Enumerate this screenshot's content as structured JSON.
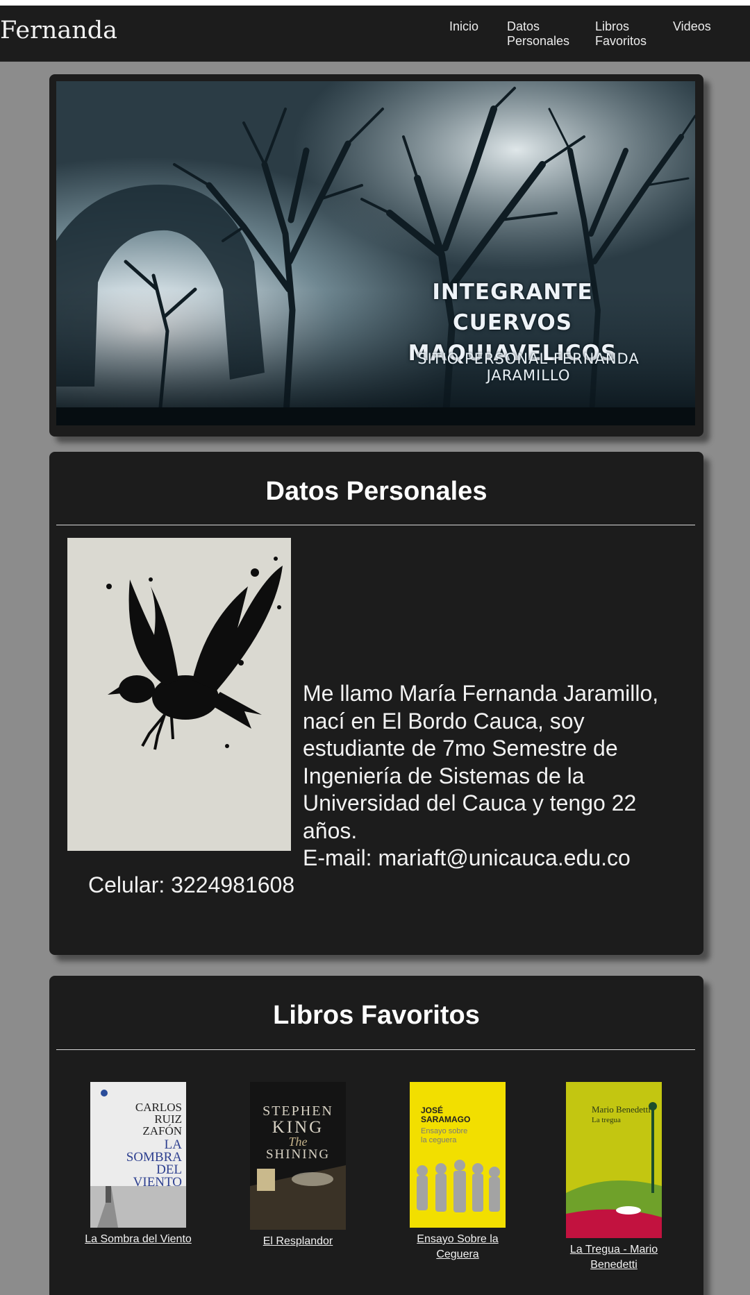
{
  "navbar": {
    "brand": "Fernanda",
    "links": [
      "Inicio",
      "Datos Personales",
      "Libros Favoritos",
      "Videos"
    ],
    "links_lines": [
      [
        "Inicio"
      ],
      [
        "Datos",
        "Personales"
      ],
      [
        "Libros",
        "Favoritos"
      ],
      [
        "Videos"
      ]
    ]
  },
  "hero": {
    "title_line1": "INTEGRANTE CUERVOS",
    "title_line2": "MAQUIAVELICOS",
    "subtitle": "SITIO PERSONAL FERNANDA JARAMILLO"
  },
  "datos": {
    "title": "Datos Personales",
    "bio": "Me llamo María Fernanda Jaramillo, nací en El Bordo Cauca, soy estudiante de 7mo Semestre de Ingeniería de Sistemas de la Universidad del Cauca y tengo 22 años.",
    "email": "E-mail: mariaft@unicauca.edu.co",
    "celular": "Celular: 3224981608"
  },
  "libros": {
    "title": "Libros Favoritos",
    "items": [
      {
        "caption": "La Sombra del Viento",
        "cover_text": [
          "CARLOS",
          "RUIZ",
          "ZAFÓN",
          "LA",
          "SOMBRA",
          "DEL",
          "VIENTO"
        ]
      },
      {
        "caption": "El Resplandor",
        "cover_text": [
          "STEPHEN",
          "KING",
          "The",
          "SHINING"
        ]
      },
      {
        "caption": "Ensayo Sobre la Ceguera",
        "cover_text": [
          "JOSÉ",
          "SARAMAGO",
          "Ensayo sobre",
          "la ceguera"
        ]
      },
      {
        "caption": "La Tregua - Mario Benedetti",
        "cover_text": [
          "Mario Benedetti",
          "La tregua"
        ]
      }
    ]
  },
  "colors": {
    "page_bg": "#8c8c8c",
    "card_bg": "#1c1c1c",
    "text": "#ffffff"
  }
}
